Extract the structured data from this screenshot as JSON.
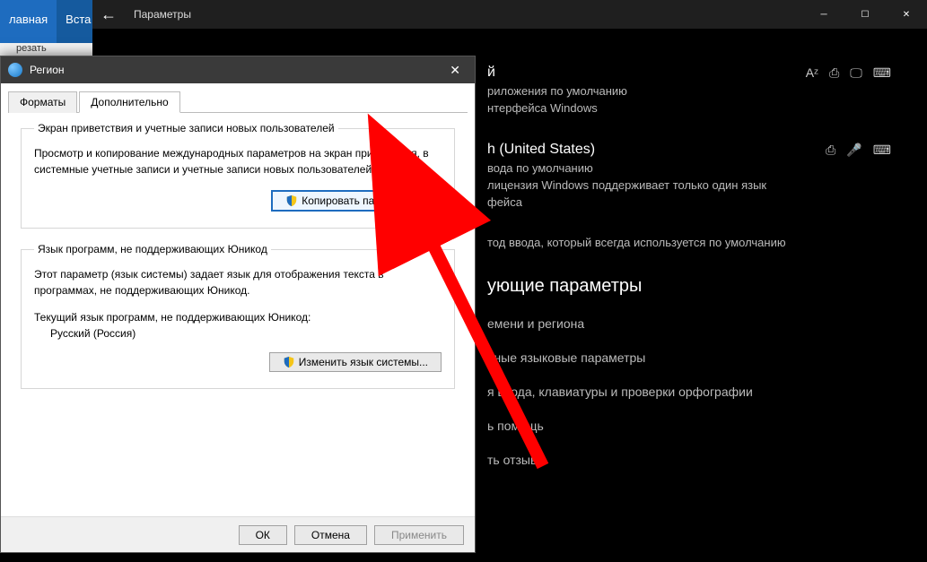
{
  "ribbon": {
    "tab_home": "лавная",
    "tab_insert": "Вста",
    "cut": "резать"
  },
  "settings": {
    "title": "Параметры",
    "lang1": {
      "name": "й",
      "sub1": "риложения по умолчанию",
      "sub2": "нтерфейса Windows"
    },
    "lang2": {
      "name": "h (United States)",
      "sub1": "вода по умолчанию",
      "sub2": "лицензия Windows поддерживает только один язык",
      "sub3": "фейса"
    },
    "default_input": "тод ввода, который всегда используется по умолчанию",
    "related_h": "ующие параметры",
    "rel1": "емени и региона",
    "rel2": "вные языковые параметры",
    "rel3": "я ввода, клавиатуры и проверки орфографии",
    "rel4": "ь помощь",
    "rel5": "ть отзыв"
  },
  "region": {
    "title": "Регион",
    "tab_formats": "Форматы",
    "tab_advanced": "Дополнительно",
    "group1_title": "Экран приветствия и учетные записи новых пользователей",
    "group1_text": "Просмотр и копирование международных параметров на экран приветствия, в системные учетные записи и учетные записи новых пользователей.",
    "btn_copy": "Копировать параметры...",
    "group2_title": "Язык программ, не поддерживающих Юникод",
    "group2_text": "Этот параметр (язык системы) задает язык для отображения текста в программах, не поддерживающих Юникод.",
    "group2_cur_label": "Текущий язык программ, не поддерживающих Юникод:",
    "group2_cur_value": "Русский (Россия)",
    "btn_change": "Изменить язык системы...",
    "btn_ok": "ОК",
    "btn_cancel": "Отмена",
    "btn_apply": "Применить"
  }
}
